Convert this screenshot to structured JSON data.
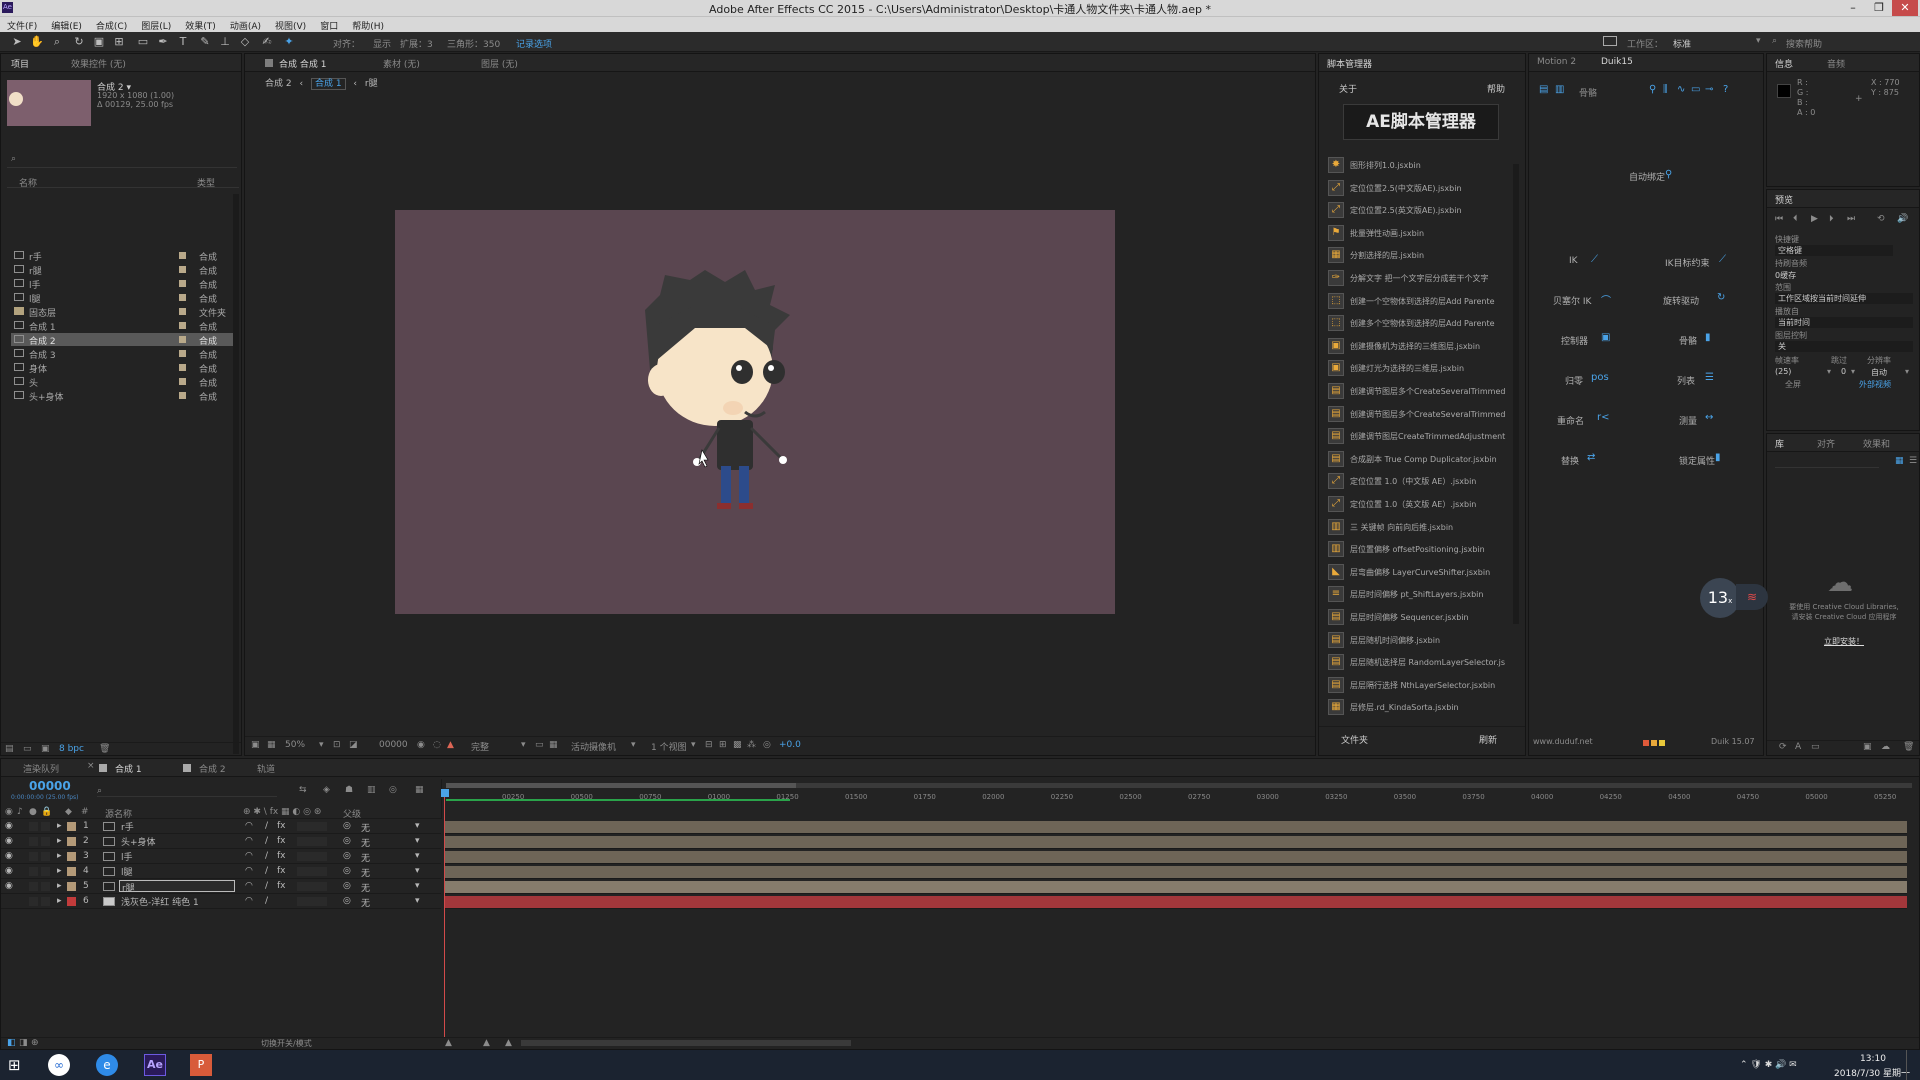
{
  "app": {
    "title": "Adobe After Effects CC 2015 - C:\\Users\\Administrator\\Desktop\\卡通人物文件夹\\卡通人物.aep *"
  },
  "menu": [
    "文件(F)",
    "编辑(E)",
    "合成(C)",
    "图层(L)",
    "效果(T)",
    "动画(A)",
    "视图(V)",
    "窗口",
    "帮助(H)"
  ],
  "toolbar": {
    "snap_label": "对齐：",
    "show_label": "显示",
    "expand_label": "扩展：3",
    "triangles_label": "三角形：350",
    "record_label": "记录选项",
    "workspace_label": "工作区：",
    "workspace_value": "标准",
    "search_help": "搜索帮助"
  },
  "project_panel": {
    "tab_project": "项目",
    "tab_effects": "效果控件 (无)",
    "comp_name": "合成 2 ▾",
    "comp_size": "1920 x 1080 (1.00)",
    "comp_duration": "Δ 00129, 25.00 fps",
    "header_name": "名称",
    "header_type": "类型",
    "bpc": "8 bpc",
    "items": [
      {
        "name": "r手",
        "type": "合成",
        "folder": false,
        "selected": false
      },
      {
        "name": "r腿",
        "type": "合成",
        "folder": false,
        "selected": false
      },
      {
        "name": "l手",
        "type": "合成",
        "folder": false,
        "selected": false
      },
      {
        "name": "l腿",
        "type": "合成",
        "folder": false,
        "selected": false
      },
      {
        "name": "固态层",
        "type": "文件夹",
        "folder": true,
        "selected": false
      },
      {
        "name": "合成 1",
        "type": "合成",
        "folder": false,
        "selected": false
      },
      {
        "name": "合成 2",
        "type": "合成",
        "folder": false,
        "selected": true
      },
      {
        "name": "合成 3",
        "type": "合成",
        "folder": false,
        "selected": false
      },
      {
        "name": "身体",
        "type": "合成",
        "folder": false,
        "selected": false
      },
      {
        "name": "头",
        "type": "合成",
        "folder": false,
        "selected": false
      },
      {
        "name": "头+身体",
        "type": "合成",
        "folder": false,
        "selected": false
      }
    ]
  },
  "viewer": {
    "tab_comp": "合成 合成 1",
    "tab_footage": "素材 (无)",
    "tab_layer": "图层 (无)",
    "breadcrumb": [
      "合成 2",
      "合成 1",
      "r腿"
    ],
    "zoom": "50%",
    "timecode": "00000",
    "quality": "完整",
    "camera": "活动摄像机",
    "views": "1 个视图",
    "exposure": "+0.0",
    "bg_color": "#5a4650"
  },
  "script_manager": {
    "tab": "脚本管理器",
    "about": "关于",
    "help": "帮助",
    "banner": "AE脚本管理器",
    "folder_btn": "文件夹",
    "refresh_btn": "刷新",
    "scripts": [
      "图形排列1.0.jsxbin",
      "定位位置2.5(中文版AE).jsxbin",
      "定位位置2.5(英文版AE).jsxbin",
      "批量弹性动画.jsxbin",
      "分割选择的层.jsxbin",
      "分解文字 把一个文字层分成若干个文字",
      "创建一个空物体到选择的层Add Parente",
      "创建多个空物体到选择的层Add Parente",
      "创建摄像机为选择的三维图层.jsxbin",
      "创建灯光为选择的三维层.jsxbin",
      "创建调节图层多个CreateSeveralTrimmed",
      "创建调节图层多个CreateSeveralTrimmed",
      "创建调节图层CreateTrimmedAdjustment",
      "合成副本 True Comp Duplicator.jsxbin",
      "定位位置 1.0（中文版 AE）.jsxbin",
      "定位位置 1.0（英文版 AE）.jsxbin",
      "三 关键帧 向前向后推.jsxbin",
      "层位置偏移 offsetPositioning.jsxbin",
      "层弯曲偏移 LayerCurveShifter.jsxbin",
      "层层时间偏移 pt_ShiftLayers.jsxbin",
      "层层时间偏移 Sequencer.jsxbin",
      "层层随机时间偏移.jsxbin",
      "层层随机选择层 RandomLayerSelector.js",
      "层层隔行选择 NthLayerSelector.jsxbin",
      "层修层.rd_KindaSorta.jsxbin"
    ]
  },
  "duik": {
    "tab_motion": "Motion 2",
    "tab_duik": "Duik15",
    "bones_label": "骨骼",
    "autorig": "自动绑定",
    "items": [
      {
        "label": "IK"
      },
      {
        "label": "IK目标约束"
      },
      {
        "label": "贝塞尔 IK"
      },
      {
        "label": "旋转驱动"
      },
      {
        "label": "控制器"
      },
      {
        "label": "骨骼"
      },
      {
        "label": "归零"
      },
      {
        "label": "列表"
      },
      {
        "label": "重命名"
      },
      {
        "label": "测量"
      },
      {
        "label": "替换"
      },
      {
        "label": "锁定属性"
      }
    ],
    "url": "www.duduf.net",
    "version": "Duik 15.07"
  },
  "info_panel": {
    "tab_info": "信息",
    "tab_audio": "音频",
    "r": "R :",
    "g": "G :",
    "b": "B :",
    "a": "A : 0",
    "x": "X : 770",
    "y": "Y : 875"
  },
  "preview_panel": {
    "tab": "预览",
    "shortcut_label": "快捷键",
    "shortcut_value": "空格键",
    "include_label": "持刷音频",
    "cache_label": "0缓存",
    "range_label": "范围",
    "range_value": "工作区域按当前时间延伸",
    "play_from_label": "播放自",
    "play_from_value": "当前时间",
    "layer_ctrl_label": "图层控制",
    "layer_ctrl_value": "关",
    "frame_rate_label": "帧速率",
    "skip_label": "跳过",
    "resolution_label": "分辨率",
    "frame_rate_value": "(25)",
    "skip_value": "0",
    "resolution_value": "自动",
    "fullscreen": "全屏",
    "external": "外部视频"
  },
  "effects_panel": {
    "tab1": "库",
    "tab2": "对齐",
    "tab3": "效果和"
  },
  "cc_library": {
    "msg1": "要使用 Creative Cloud Libraries,",
    "msg2": "请安装 Creative Cloud 应用程序",
    "link": "立即安装！"
  },
  "float_widget": {
    "value": "13",
    "unit": "x"
  },
  "timeline": {
    "tab_render": "渲染队列",
    "tab_comp1": "合成 1",
    "tab_comp2": "合成 2",
    "tab_track": "轨道",
    "timecode": "00000",
    "timecode_sub": "0:00:00:00 (25.00 fps)",
    "col_source": "源名称",
    "col_parent": "父级",
    "toggle_label": "切换开关/模式",
    "ruler": [
      "00250",
      "00500",
      "00750",
      "01000",
      "01250",
      "01500",
      "01750",
      "02000",
      "02250",
      "02500",
      "02750",
      "03000",
      "03250",
      "03500",
      "03750",
      "04000",
      "04250",
      "04500",
      "04750",
      "05000",
      "05250"
    ],
    "layers": [
      {
        "num": "1",
        "name": "r手",
        "parent": "无",
        "label_color": "#b49a78",
        "red": false,
        "selected": false
      },
      {
        "num": "2",
        "name": "头+身体",
        "parent": "无",
        "label_color": "#b49a78",
        "red": false,
        "selected": false
      },
      {
        "num": "3",
        "name": "l手",
        "parent": "无",
        "label_color": "#b49a78",
        "red": false,
        "selected": false
      },
      {
        "num": "4",
        "name": "l腿",
        "parent": "无",
        "label_color": "#b49a78",
        "red": false,
        "selected": false
      },
      {
        "num": "5",
        "name": "r腿",
        "parent": "无",
        "label_color": "#b49a78",
        "red": false,
        "selected": true
      },
      {
        "num": "6",
        "name": "浅灰色-洋红 纯色 1",
        "parent": "无",
        "label_color": "#c23b3b",
        "red": true,
        "selected": false
      }
    ]
  },
  "taskbar": {
    "time": "13:10",
    "date": "2018/7/30 星期一"
  }
}
